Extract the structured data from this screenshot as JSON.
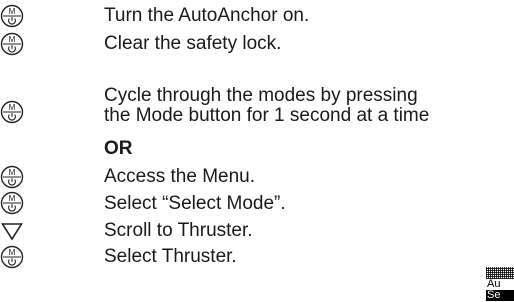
{
  "steps": [
    {
      "icon": "mode-power-button-icon",
      "text": "Turn the AutoAnchor on."
    },
    {
      "icon": "mode-power-button-icon",
      "text": "Clear the safety lock."
    },
    {
      "icon": "mode-power-button-icon",
      "text_line1": "Cycle through the modes by pressing",
      "text_line2": "the Mode button for 1 second at a time"
    },
    {
      "text": "OR"
    },
    {
      "icon": "mode-power-button-icon",
      "text": "Access the Menu."
    },
    {
      "icon": "mode-power-button-icon",
      "text": "Select “Select Mode”."
    },
    {
      "icon": "down-triangle-icon",
      "text": "Scroll to Thruster."
    },
    {
      "icon": "mode-power-button-icon",
      "text": "Select Thruster."
    }
  ],
  "icon_label": "M",
  "thumbnail": {
    "line1": "Au",
    "line2": "Se"
  }
}
